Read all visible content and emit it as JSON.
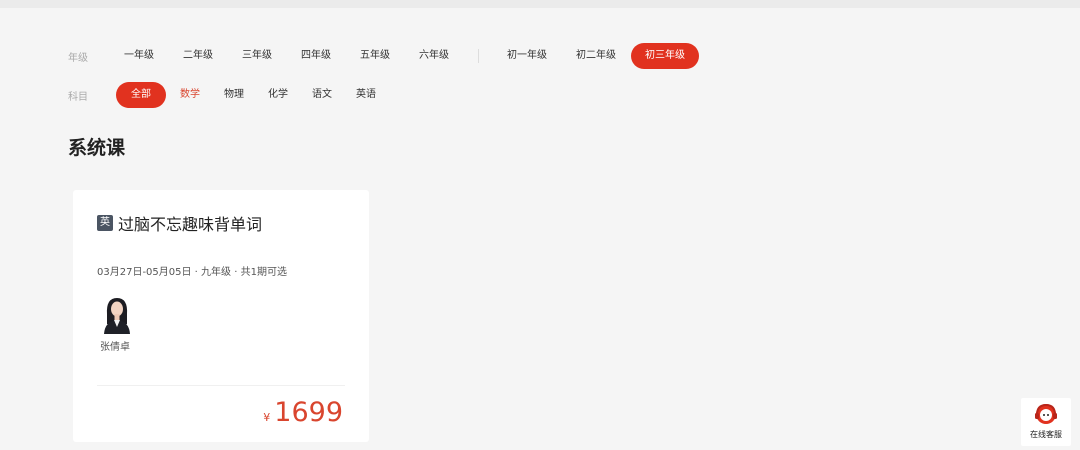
{
  "filters": {
    "grade": {
      "label": "年级",
      "options": [
        "一年级",
        "二年级",
        "三年级",
        "四年级",
        "五年级",
        "六年级"
      ],
      "options_secondary": [
        "初一年级",
        "初二年级",
        "初三年级"
      ],
      "selected": "初三年级"
    },
    "subject": {
      "label": "科目",
      "options": [
        "全部",
        "数学",
        "物理",
        "化学",
        "语文",
        "英语"
      ],
      "selected": "全部"
    }
  },
  "section": {
    "title": "系统课"
  },
  "course": {
    "subject_tag": "英",
    "name": "过脑不忘趣味背单词",
    "meta": "03月27日-05月05日 · 九年级 · 共1期可选",
    "teacher_name": "张倩卓",
    "price_symbol": "¥",
    "price_value": "1699"
  },
  "service": {
    "label": "在线客服"
  },
  "colors": {
    "accent": "#e1321f",
    "price": "#d9452e"
  }
}
